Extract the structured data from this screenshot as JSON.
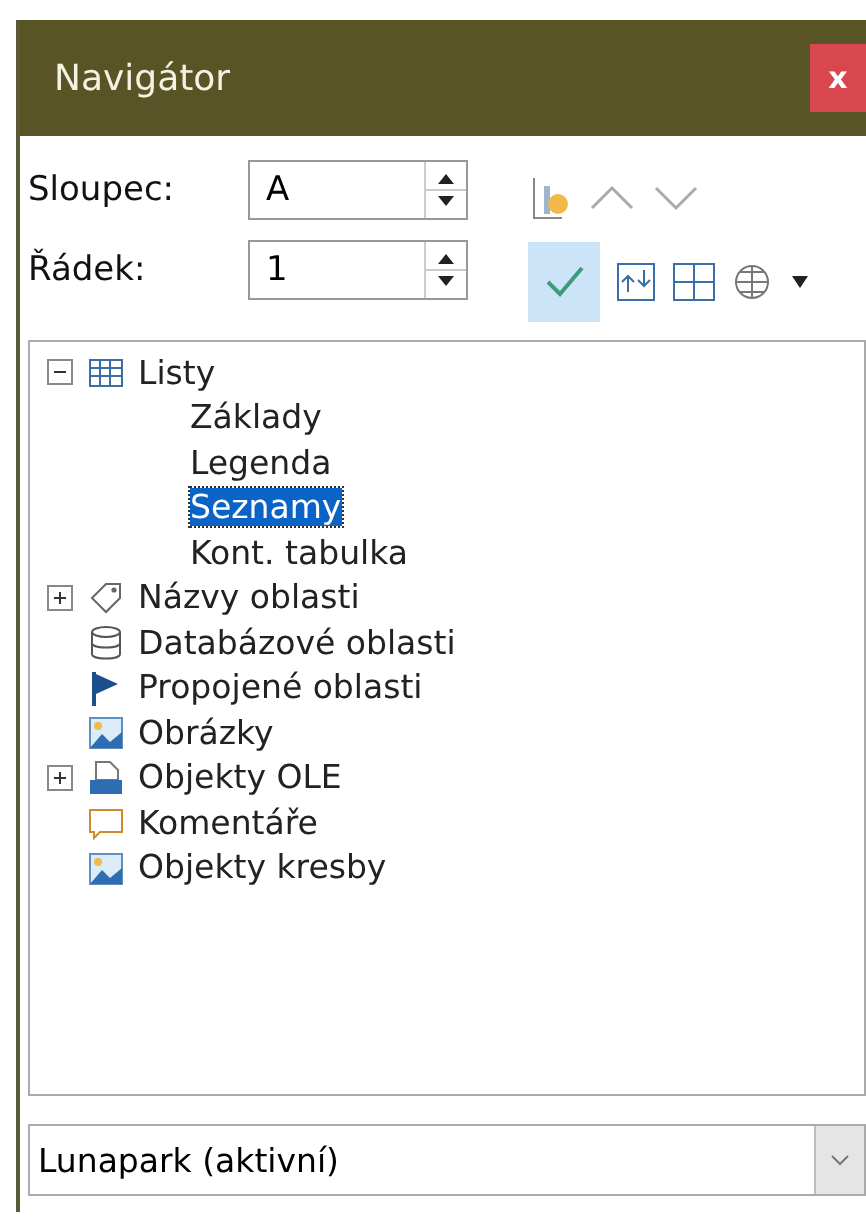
{
  "window": {
    "title": "Navigátor",
    "close": "x"
  },
  "fields": [
    {
      "label": "Sloupec:",
      "value": "A"
    },
    {
      "label": "Řádek:",
      "value": "1"
    }
  ],
  "toolbar": {
    "content_toggle": {
      "on": true
    }
  },
  "tree": [
    {
      "kind": "sheets",
      "label": "Listy",
      "expanded": true,
      "selected": false,
      "children": [
        {
          "label": "Základy",
          "selected": false
        },
        {
          "label": "Legenda",
          "selected": false
        },
        {
          "label": "Seznamy",
          "selected": true
        },
        {
          "label": "Kont. tabulka",
          "selected": false
        }
      ]
    },
    {
      "kind": "names",
      "label": "Názvy oblasti",
      "expanded": false,
      "selected": false
    },
    {
      "kind": "database",
      "label": "Databázové oblasti",
      "selected": false
    },
    {
      "kind": "linked",
      "label": "Propojené oblasti",
      "selected": false
    },
    {
      "kind": "images",
      "label": "Obrázky",
      "selected": false
    },
    {
      "kind": "ole",
      "label": "Objekty OLE",
      "expanded": false,
      "selected": false
    },
    {
      "kind": "comments",
      "label": "Komentáře",
      "selected": false
    },
    {
      "kind": "drawings",
      "label": "Objekty kresby",
      "selected": false
    }
  ],
  "document_select": {
    "value": "Lunapark (aktivní)"
  }
}
